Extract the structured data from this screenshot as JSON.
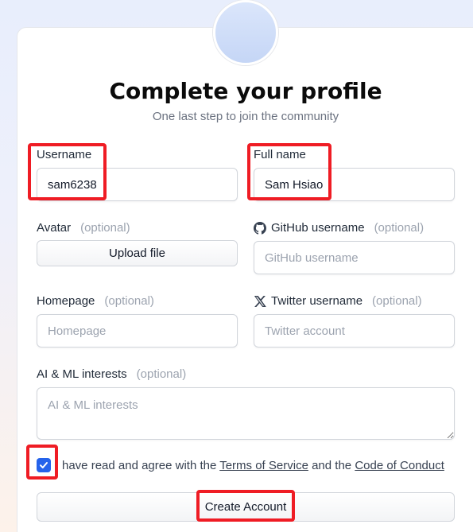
{
  "header": {
    "title": "Complete your profile",
    "subtitle": "One last step to join the community"
  },
  "fields": {
    "username": {
      "label": "Username",
      "value": "sam6238"
    },
    "fullname": {
      "label": "Full name",
      "value": "Sam Hsiao"
    },
    "avatar": {
      "label": "Avatar",
      "optional": "(optional)",
      "button": "Upload file"
    },
    "github": {
      "label": "GitHub username",
      "optional": "(optional)",
      "placeholder": "GitHub username",
      "icon": "github-icon"
    },
    "homepage": {
      "label": "Homepage",
      "optional": "(optional)",
      "placeholder": "Homepage"
    },
    "twitter": {
      "label": "Twitter username",
      "optional": "(optional)",
      "placeholder": "Twitter account",
      "icon": "x-twitter-icon"
    },
    "interests": {
      "label": "AI & ML interests",
      "optional": "(optional)",
      "placeholder": "AI & ML interests"
    }
  },
  "agreement": {
    "checked": true,
    "prefix": "have read and agree with the",
    "terms_link": "Terms of Service",
    "middle": "and the",
    "conduct_link": "Code of Conduct"
  },
  "submit": {
    "label": "Create Account"
  },
  "colors": {
    "highlight": "#ef1c24",
    "checkbox": "#2563eb"
  }
}
